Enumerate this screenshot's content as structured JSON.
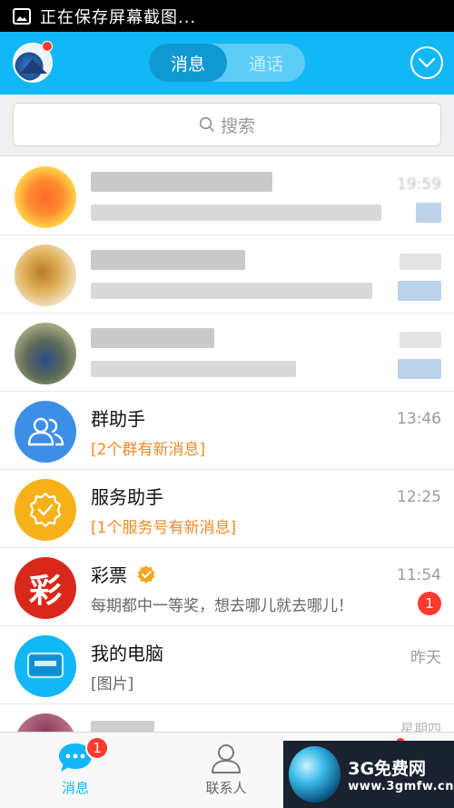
{
  "status_bar": {
    "text": "正在保存屏幕截图..."
  },
  "header": {
    "tabs": [
      {
        "label": "消息",
        "active": true
      },
      {
        "label": "通话",
        "active": false
      }
    ]
  },
  "search": {
    "placeholder": "搜索"
  },
  "conversations": [
    {
      "name": "群助手",
      "subtitle": "[2个群有新消息]",
      "time": "13:46"
    },
    {
      "name": "服务助手",
      "subtitle": "[1个服务号有新消息]",
      "time": "12:25"
    },
    {
      "name": "彩票",
      "avatar_text": "彩",
      "subtitle": "每期都中一等奖，想去哪儿就去哪儿！",
      "time": "11:54",
      "badge": "1"
    },
    {
      "name": "我的电脑",
      "subtitle": "[图片]",
      "time": "昨天"
    }
  ],
  "blurred_times": [
    "19:59",
    "星期四"
  ],
  "bottom_nav": [
    {
      "label": "消息",
      "badge": "1",
      "active": true
    },
    {
      "label": "联系人",
      "active": false
    }
  ],
  "watermark": {
    "title": "3G免费网",
    "url": "www.3gmfw.cn"
  },
  "colors": {
    "accent": "#12b7f5",
    "badge": "#ff3b30",
    "orange": "#f08a24"
  }
}
